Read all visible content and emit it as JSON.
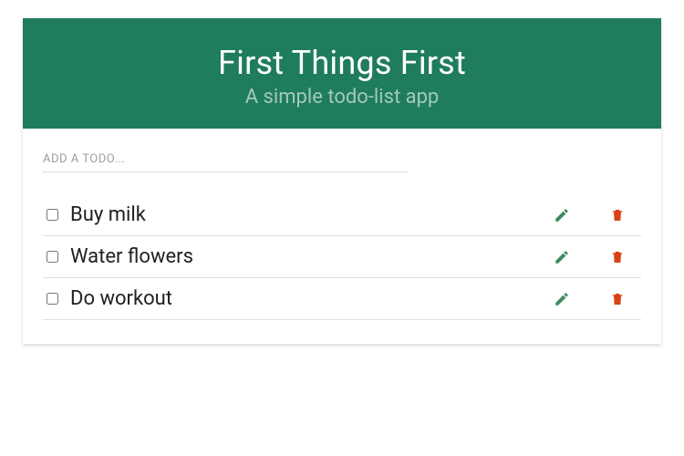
{
  "header": {
    "title": "First Things First",
    "subtitle": "A simple todo-list app"
  },
  "input": {
    "placeholder": "Add a todo..."
  },
  "todos": [
    {
      "label": "Buy milk",
      "checked": false
    },
    {
      "label": "Water flowers",
      "checked": false
    },
    {
      "label": "Do workout",
      "checked": false
    }
  ],
  "colors": {
    "headerBg": "#1f7c5c",
    "edit": "#3b8c5f",
    "delete": "#d84315"
  }
}
